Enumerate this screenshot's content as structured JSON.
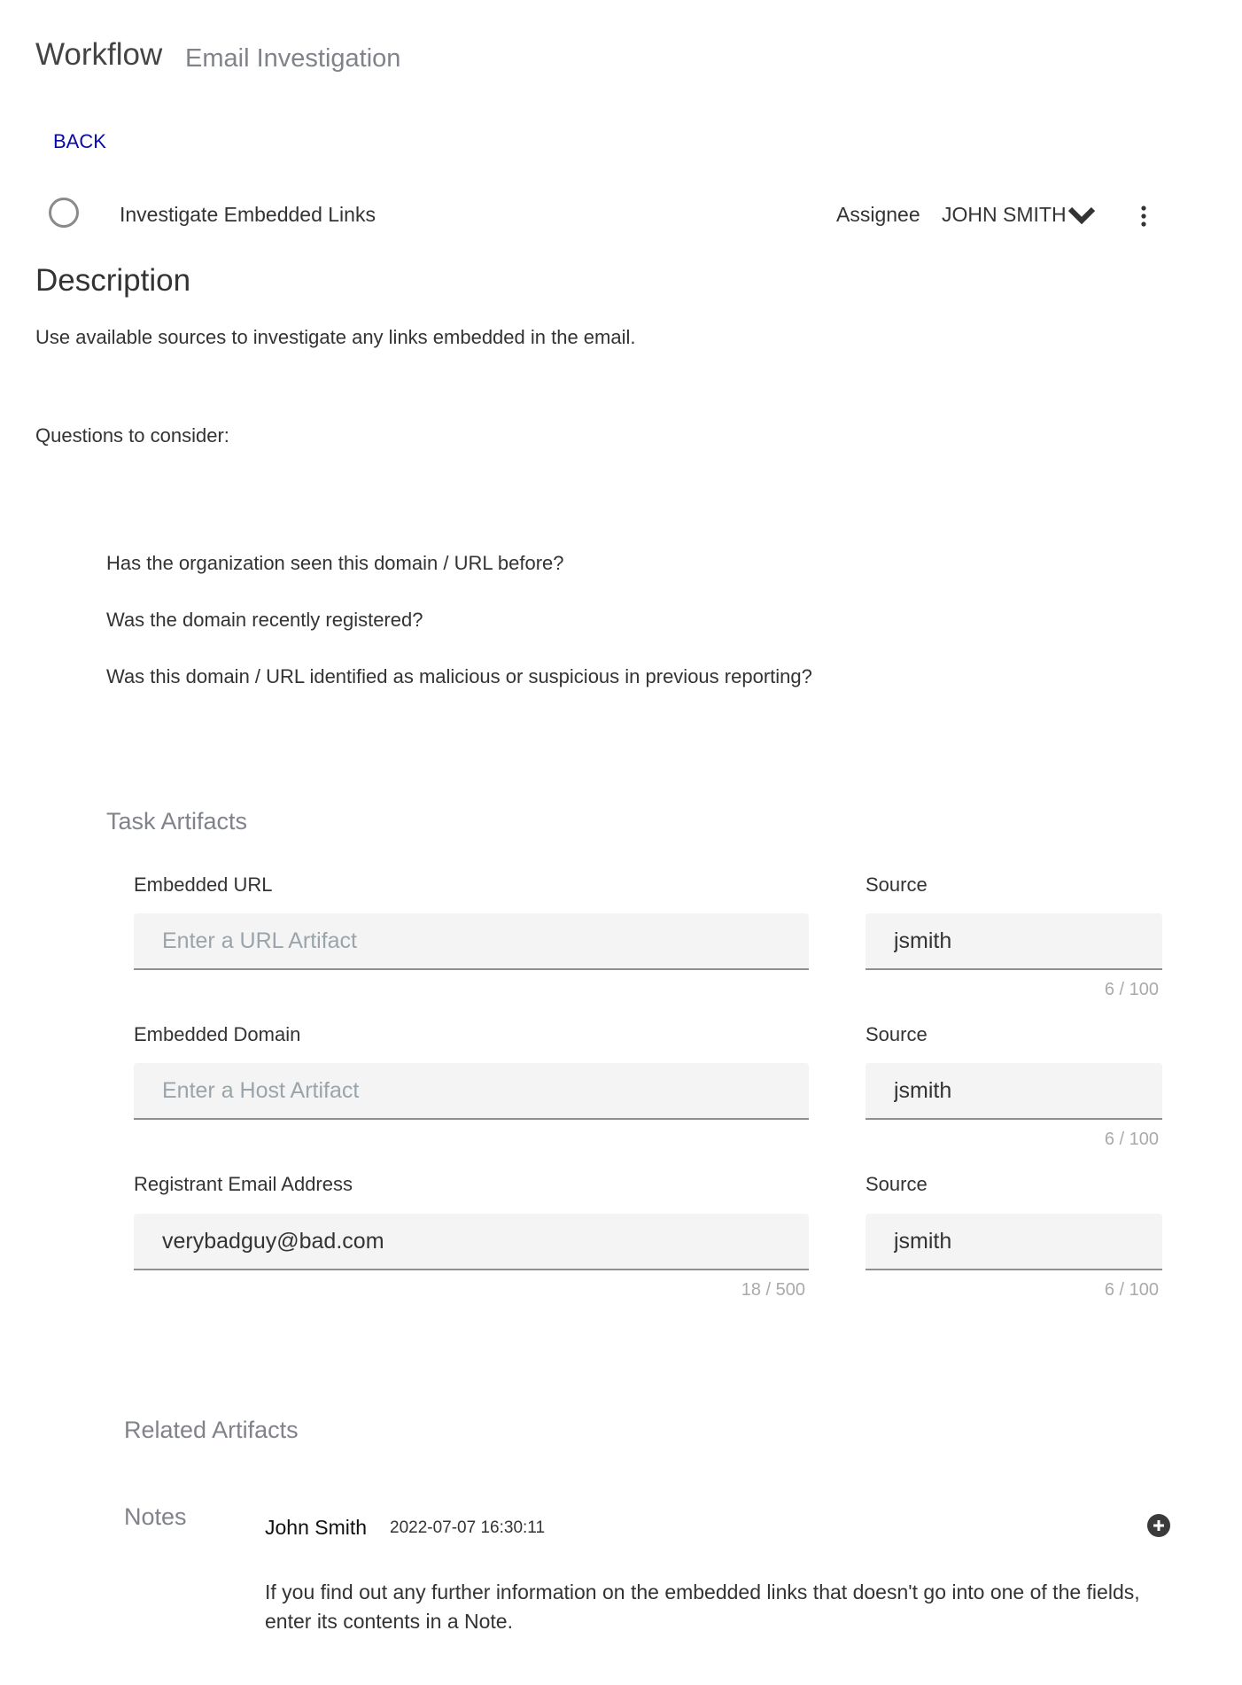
{
  "header": {
    "title": "Workflow",
    "subtitle": "Email Investigation",
    "back_label": "BACK"
  },
  "task": {
    "name": "Investigate Embedded Links",
    "assignee_label": "Assignee",
    "assignee": "JOHN SMITH",
    "icons": [
      "circle-checkbox-icon",
      "chevron-down-icon",
      "more-vert-icon"
    ]
  },
  "description": {
    "heading": "Description",
    "text": "Use available sources to investigate any links embedded in the email.",
    "questions_label": "Questions to consider:",
    "questions": [
      "Has the organization seen this domain / URL before?",
      "Was the domain recently registered?",
      "Was this domain / URL identified as malicious or suspicious in previous reporting?"
    ]
  },
  "task_artifacts": {
    "heading": "Task Artifacts",
    "rows": [
      {
        "label": "Embedded URL",
        "value": "",
        "placeholder": "Enter a URL Artifact",
        "counter": "",
        "source_label": "Source",
        "source": "jsmith",
        "source_counter": "6 / 100"
      },
      {
        "label": "Embedded Domain",
        "value": "",
        "placeholder": "Enter a Host Artifact",
        "counter": "",
        "source_label": "Source",
        "source": "jsmith",
        "source_counter": "6 / 100"
      },
      {
        "label": "Registrant Email Address",
        "value": "verybadguy@bad.com",
        "placeholder": "",
        "counter": "18 / 500",
        "source_label": "Source",
        "source": "jsmith",
        "source_counter": "6 / 100"
      }
    ]
  },
  "related_artifacts": {
    "heading": "Related Artifacts"
  },
  "notes": {
    "heading": "Notes",
    "items": [
      {
        "author": "John Smith",
        "timestamp": "2022-07-07 16:30:11",
        "text": "If you find out any further information on the embedded links that doesn't go into one of the fields, enter its contents in a Note."
      }
    ]
  }
}
